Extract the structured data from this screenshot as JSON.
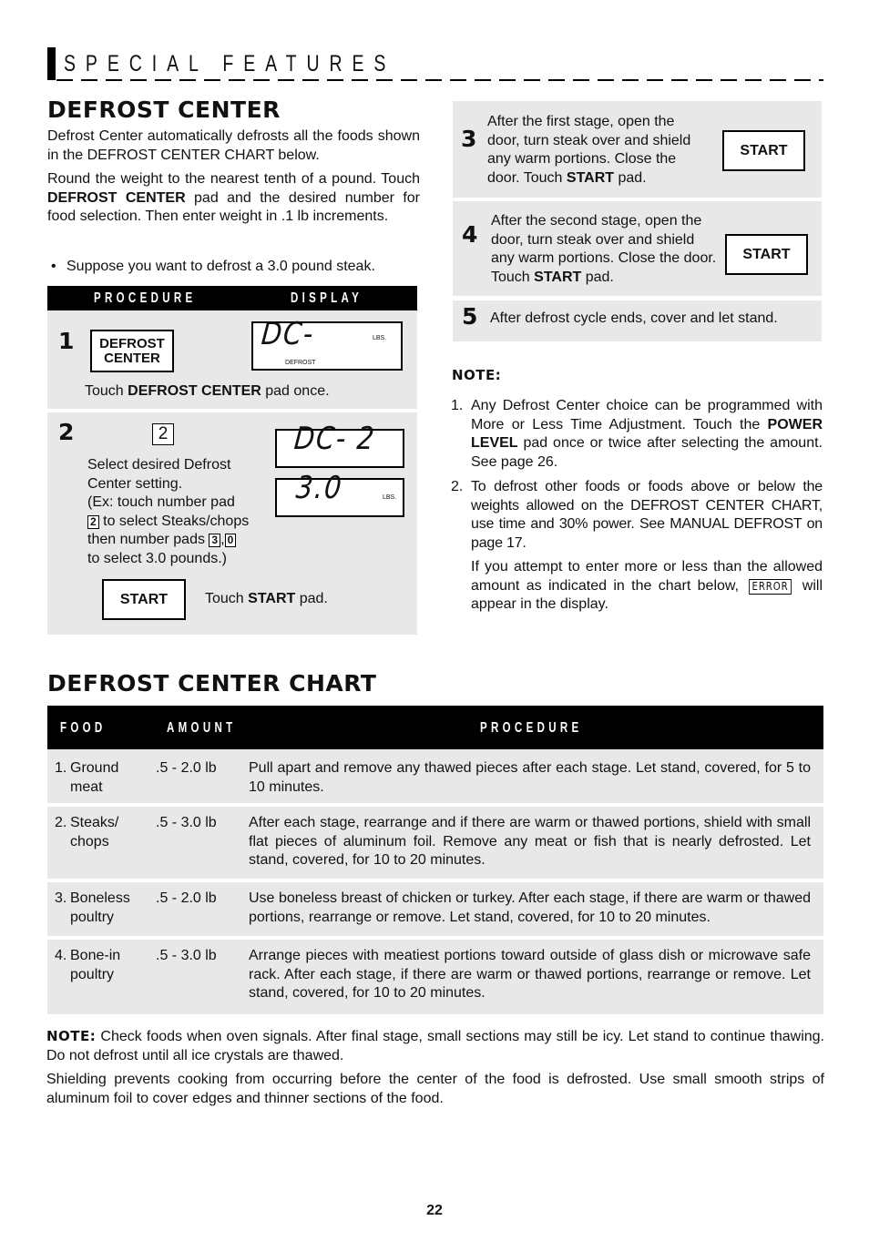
{
  "header": {
    "title": "SPECIAL FEATURES"
  },
  "defrost_center": {
    "title": "DEFROST CENTER",
    "intro": "Defrost Center automatically defrosts all the foods shown in the DEFROST CENTER CHART below.",
    "para2_pre": "Round the weight to the nearest tenth of a pound. Touch ",
    "para2_bold": "DEFROST CENTER",
    "para2_post": " pad and the desired number for food selection. Then enter weight in .1 lb increments.",
    "bullet": "Suppose you want to defrost a 3.0 pound steak."
  },
  "procedure_table": {
    "col_procedure": "PROCEDURE",
    "col_display": "DISPLAY",
    "step1": {
      "number": "1",
      "pad_label_line1": "DEFROST",
      "pad_label_line2": "CENTER",
      "display_main": "DC-",
      "display_unit": "LBS.",
      "display_indicator": "DEFROST",
      "text_pre": "Touch ",
      "text_bold": "DEFROST CENTER",
      "text_post": " pad once."
    },
    "step2": {
      "number": "2",
      "key_top": "2",
      "line1": "Select desired Defrost",
      "line2": "Center setting.",
      "line3": "(Ex: touch number pad",
      "key_a": "2",
      "line4": " to select Steaks/chops",
      "line5_pre": "then number pads ",
      "key_b": "3",
      "key_sep": ",",
      "key_c": "0",
      "line6": "to select 3.0 pounds.)",
      "display1_main": "DC- 2",
      "display2_main": "3.0",
      "display2_unit": "LBS.",
      "start_label": "START",
      "touch_pre": "Touch ",
      "touch_bold": "START",
      "touch_post": " pad."
    }
  },
  "right_steps": [
    {
      "number": "3",
      "text_pre": "After the first stage, open the door, turn steak over and shield any warm portions. Close the door. Touch ",
      "text_bold": "START",
      "text_post": " pad.",
      "button": "START"
    },
    {
      "number": "4",
      "text_pre": "After the second stage, open the door, turn steak over and shield any warm portions. Close the door. Touch ",
      "text_bold": "START",
      "text_post": " pad.",
      "button": "START"
    },
    {
      "number": "5",
      "text": "After defrost cycle ends, cover and let stand."
    }
  ],
  "note": {
    "title": "NOTE:",
    "item1_num": "1.",
    "item1_pre": "Any Defrost Center choice can be programmed with More or  Less Time Adjustment. Touch the ",
    "item1_bold": "POWER LEVEL",
    "item1_post": " pad once or twice after selecting the amount. See page 26.",
    "item2_num": "2.",
    "item2": "To defrost other foods or foods above or below the weights allowed on the DEFROST CENTER CHART, use time and 30% power. See MANUAL DEFROST on page 17.",
    "item2b_pre": "If you attempt to enter more or less than the allowed amount as indicated in the chart below,",
    "error_display": "ERROR",
    "item2b_post": "will appear in the display."
  },
  "chart": {
    "title": "DEFROST CENTER CHART",
    "columns": [
      "FOOD",
      "AMOUNT",
      "PROCEDURE"
    ],
    "rows": [
      {
        "food_num": "1.",
        "food": "Ground meat",
        "food_l1": "Ground",
        "food_l2": "meat",
        "amount": ".5 - 2.0 lb",
        "procedure": "Pull apart and remove any thawed pieces after each stage. Let stand, covered, for 5 to 10 minutes."
      },
      {
        "food_num": "2.",
        "food": "Steaks/ chops",
        "food_l1": "Steaks/",
        "food_l2": "chops",
        "amount": ".5 - 3.0 lb",
        "procedure": "After each stage, rearrange and if there are warm or thawed portions, shield   with small flat pieces of aluminum foil. Remove any meat or fish that is nearly defrosted. Let stand, covered, for 10 to 20 minutes."
      },
      {
        "food_num": "3.",
        "food": "Boneless poultry",
        "food_l1": "Boneless",
        "food_l2": "poultry",
        "amount": ".5 - 2.0 lb",
        "procedure": "Use boneless breast of chicken or turkey. After each stage, if there are warm or thawed portions, rearrange or remove. Let stand, covered, for 10 to 20 minutes."
      },
      {
        "food_num": "4.",
        "food": "Bone-in poultry",
        "food_l1": "Bone-in",
        "food_l2": "poultry",
        "amount": ".5 - 3.0 lb",
        "procedure": "Arrange pieces with meatiest portions toward outside of glass dish or microwave safe rack. After each stage, if there are warm or thawed portions, rearrange or remove. Let stand, covered, for 10 to 20 minutes."
      }
    ]
  },
  "bottom_note": {
    "label": "NOTE:",
    "text": " Check foods when oven signals. After final stage, small sections may still be icy. Let stand to continue thawing. Do not defrost until all ice crystals are thawed.",
    "shielding": "Shielding prevents cooking from occurring before the center of the food is defrosted. Use small smooth strips of aluminum foil to cover edges and thinner sections of the food."
  },
  "footer": {
    "page_number": "22"
  }
}
